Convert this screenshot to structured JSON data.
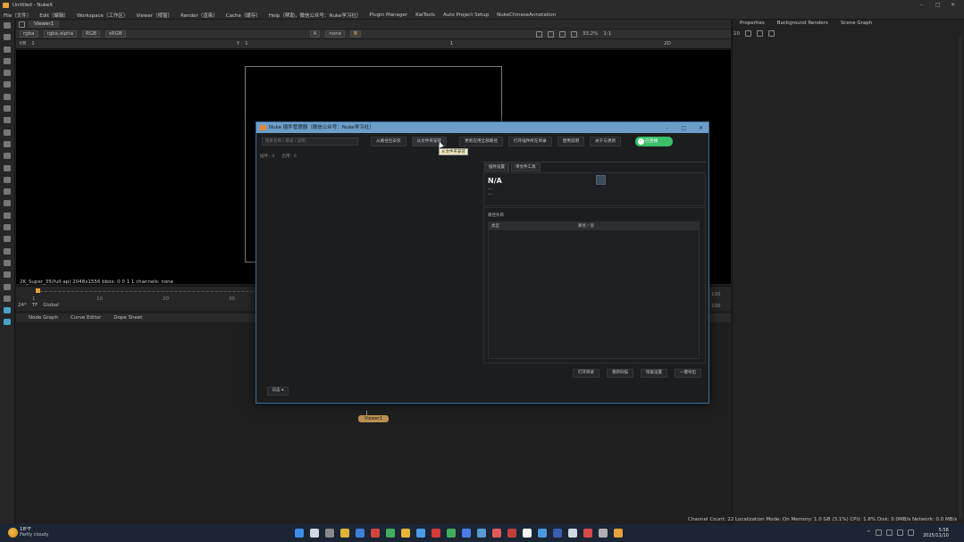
{
  "window": {
    "title": "Untitled - NukeX",
    "controls": [
      "–",
      "□",
      "✕"
    ]
  },
  "menubar": [
    "File（文件）",
    "Edit（编辑）",
    "Workspace（工作区）",
    "Viewer（视窗）",
    "Render（渲染）",
    "Cache（缓存）",
    "Help（帮助，微信公众号：Nuke学习社）",
    "Plugin Manager",
    "KaiTools",
    "Auto Project Setup",
    "NukeChineseAnnotation"
  ],
  "viewer": {
    "tab": "Viewer1",
    "bar1": [
      "rgba",
      "rgba.alpha",
      "RGB",
      "sRGB"
    ],
    "bar1_right": [
      "A",
      "none",
      "B"
    ],
    "zoom": "33.2%",
    "ratio": "1:1",
    "mode": "2D",
    "frame_label": "f/8",
    "frame_val": "1",
    "y_label": "Y",
    "y_val": "1",
    "gain": "1",
    "info": "2K_Super_35(full-ap) 2048x1556  bbox: 0 0 1 1 channels: none"
  },
  "timeline": {
    "ticks": [
      "1",
      "10",
      "20",
      "30"
    ],
    "end_ticks": [
      "100",
      "100"
    ],
    "fps": "24*",
    "tf": "TF",
    "scope": "Global"
  },
  "nodegraph": {
    "tabs": [
      "Node Graph",
      "Curve Editor",
      "Dope Sheet"
    ],
    "viewer_node": "Viewer1"
  },
  "rightpanel": {
    "tabs": [
      "Properties",
      "Background Renders",
      "Scene Graph"
    ],
    "value": "10",
    "status": "Channel Count: 22  Localization Mode: On  Memory: 1.0 GB (3.1%)  CPU: 1.6%  Disk: 0.0MB/s  Network: 0.0 MB/s"
  },
  "dialog": {
    "title": "Nuke 插件管理器（微信公众号：Nuke学习社）",
    "search_placeholder": "搜索名称 / 目录 / 说明...",
    "tabs": [
      "从路径包安装",
      "从文件夹安装",
      "更新应用全部路径",
      "打开插件所在目录",
      "使用说明",
      "关于与更新"
    ],
    "connect": "已连接",
    "tooltip": "从文件夹安装",
    "stats": [
      "插件：0",
      "启用：0"
    ],
    "subtabs": [
      "插件设置",
      "单文件工具"
    ],
    "plugin_name": "N/A",
    "sub1": "—",
    "sub2": "—",
    "section": "路径条目",
    "table_headers": [
      "类型",
      "路径 / 值"
    ],
    "buttons": [
      "打开目录",
      "重新扫描",
      "恢复设置",
      "一键导出"
    ],
    "log_button": "日志 ▾"
  },
  "taskbar": {
    "temp": "18°F",
    "weather": "Partly cloudy",
    "time": "5:58",
    "date": "2025/11/10",
    "icon_colors": [
      "#3a8ee6",
      "#cfd8e3",
      "#8a8a8a",
      "#e0b33a",
      "#3d7fd9",
      "#d0453b",
      "#3fae5a",
      "#e6b53a",
      "#4c9be8",
      "#d43b3b",
      "#3fae5a",
      "#4c7be8",
      "#5a9ad6",
      "#e05a5a",
      "#c0413b",
      "#f2f2f2",
      "#4a9ae0",
      "#3a5fb0",
      "#cfd8e3",
      "#d64a4a",
      "#b0b0b0",
      "#e6a23a"
    ]
  }
}
